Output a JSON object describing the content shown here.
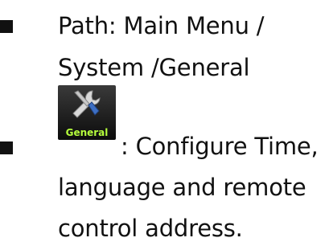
{
  "items": [
    {
      "lines": [
        "Path: Main Menu /",
        "System /General"
      ]
    },
    {
      "icon": {
        "name": "general-settings-icon",
        "label": "General"
      },
      "lines": [
        ":  Configure Time,",
        "language and remote",
        "control address."
      ]
    }
  ],
  "colors": {
    "bullet": "#111111",
    "icon_label": "#b6ff3c",
    "icon_bg": "#1a1a1a"
  }
}
